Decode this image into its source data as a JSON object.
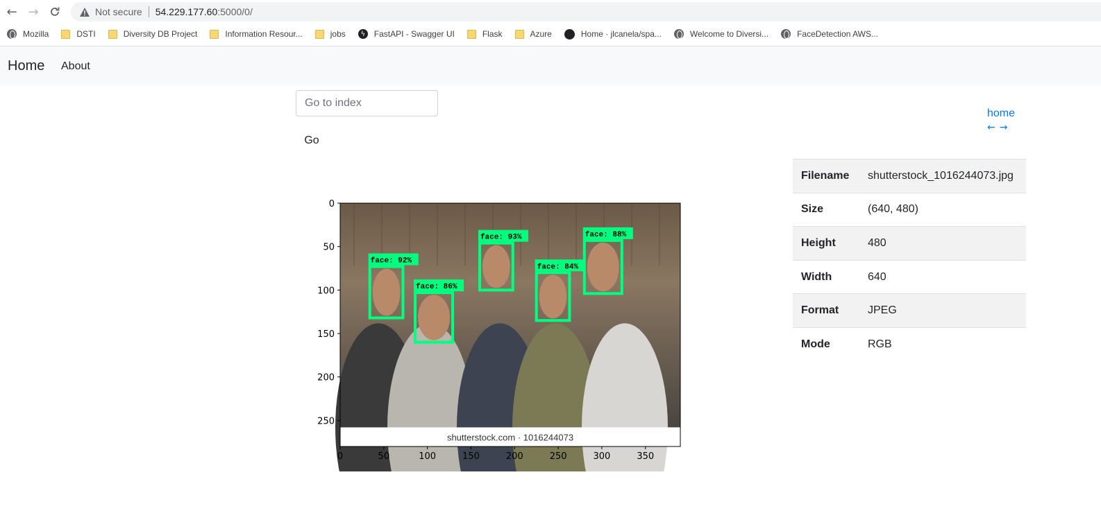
{
  "browser": {
    "security_label": "Not secure",
    "url_host": "54.229.177.60",
    "url_path": ":5000/0/",
    "bookmarks": [
      {
        "label": "Mozilla",
        "icon": "globe-icon"
      },
      {
        "label": "DSTI",
        "icon": "folder-icon"
      },
      {
        "label": "Diversity DB Project",
        "icon": "folder-icon"
      },
      {
        "label": "Information Resour...",
        "icon": "folder-icon"
      },
      {
        "label": "jobs",
        "icon": "folder-icon"
      },
      {
        "label": "FastAPI - Swagger UI",
        "icon": "fastapi-icon"
      },
      {
        "label": "Flask",
        "icon": "folder-icon"
      },
      {
        "label": "Azure",
        "icon": "folder-icon"
      },
      {
        "label": "Home · jlcanela/spa...",
        "icon": "github-icon"
      },
      {
        "label": "Welcome to Diversi...",
        "icon": "globe-icon"
      },
      {
        "label": "FaceDetection AWS...",
        "icon": "globe-icon"
      }
    ]
  },
  "navbar": {
    "brand": "Home",
    "about": "About"
  },
  "form": {
    "index_placeholder": "Go to index",
    "go_label": "Go"
  },
  "links": {
    "home": "home",
    "prev": "←",
    "next": "→"
  },
  "info": {
    "rows": [
      {
        "key": "Filename",
        "value": "shutterstock_1016244073.jpg"
      },
      {
        "key": "Size",
        "value": "(640, 480)"
      },
      {
        "key": "Height",
        "value": "480"
      },
      {
        "key": "Width",
        "value": "640"
      },
      {
        "key": "Format",
        "value": "JPEG"
      },
      {
        "key": "Mode",
        "value": "RGB"
      }
    ]
  },
  "image": {
    "watermark": "shutterstock.com · 1016244073",
    "box_color": "#00ff7f",
    "detections": [
      {
        "label": "face: 92%",
        "x0": 34,
        "y0": 73,
        "x1": 72,
        "y1": 132
      },
      {
        "label": "face: 86%",
        "x0": 86,
        "y0": 103,
        "x1": 129,
        "y1": 160
      },
      {
        "label": "face: 93%",
        "x0": 160,
        "y0": 46,
        "x1": 198,
        "y1": 100
      },
      {
        "label": "face: 84%",
        "x0": 225,
        "y0": 80,
        "x1": 263,
        "y1": 135
      },
      {
        "label": "face: 88%",
        "x0": 280,
        "y0": 43,
        "x1": 323,
        "y1": 104
      }
    ]
  },
  "chart_data": {
    "type": "image",
    "xlim": [
      0,
      390
    ],
    "ylim": [
      280,
      0
    ],
    "xticks": [
      0,
      50,
      100,
      150,
      200,
      250,
      300,
      350
    ],
    "yticks": [
      0,
      50,
      100,
      150,
      200,
      250
    ],
    "grid": false
  }
}
